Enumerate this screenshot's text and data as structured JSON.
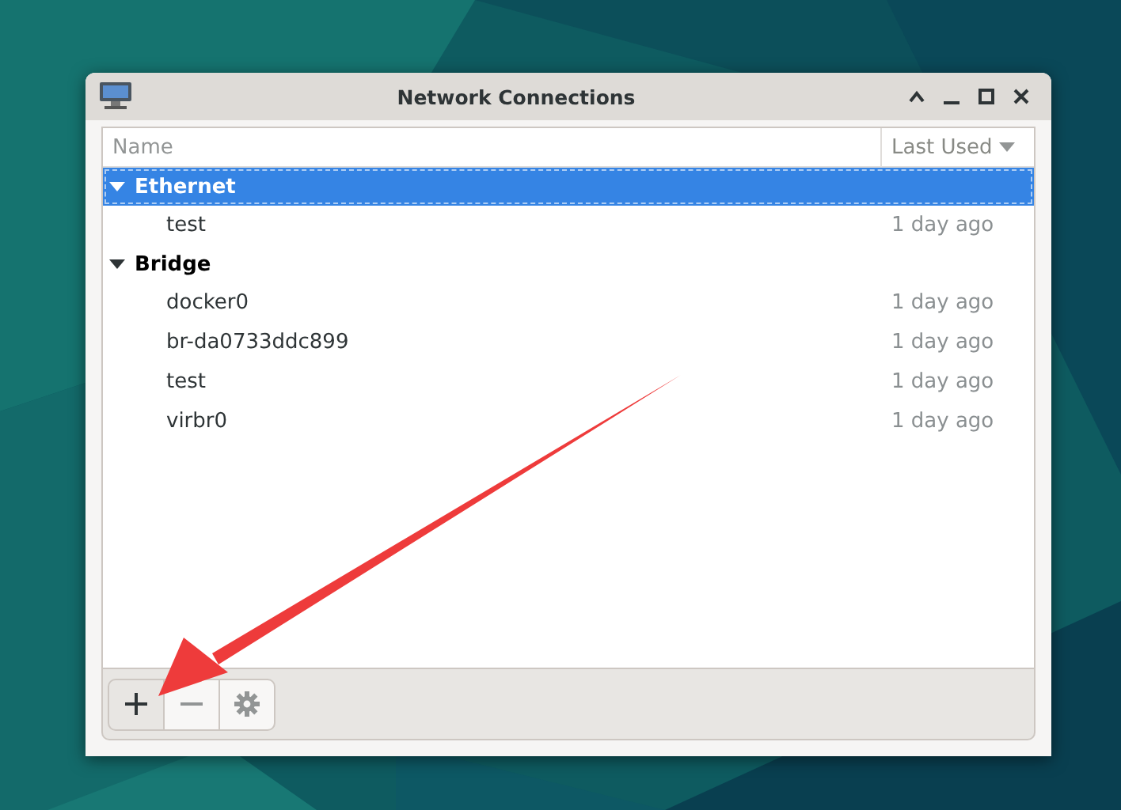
{
  "window": {
    "title": "Network Connections"
  },
  "table": {
    "columns": [
      {
        "label": "Name",
        "sorted": false
      },
      {
        "label": "Last Used",
        "sorted": true
      }
    ],
    "groups": [
      {
        "label": "Ethernet",
        "expanded": true,
        "selected": true,
        "rows": [
          {
            "name": "test",
            "last_used": "1 day ago"
          }
        ]
      },
      {
        "label": "Bridge",
        "expanded": true,
        "selected": false,
        "rows": [
          {
            "name": "docker0",
            "last_used": "1 day ago"
          },
          {
            "name": "br-da0733ddc899",
            "last_used": "1 day ago"
          },
          {
            "name": "test",
            "last_used": "1 day ago"
          },
          {
            "name": "virbr0",
            "last_used": "1 day ago"
          }
        ]
      }
    ]
  },
  "toolbar": [
    {
      "kind": "add",
      "disabled": false
    },
    {
      "kind": "remove",
      "disabled": true
    },
    {
      "kind": "settings",
      "disabled": true
    }
  ]
}
